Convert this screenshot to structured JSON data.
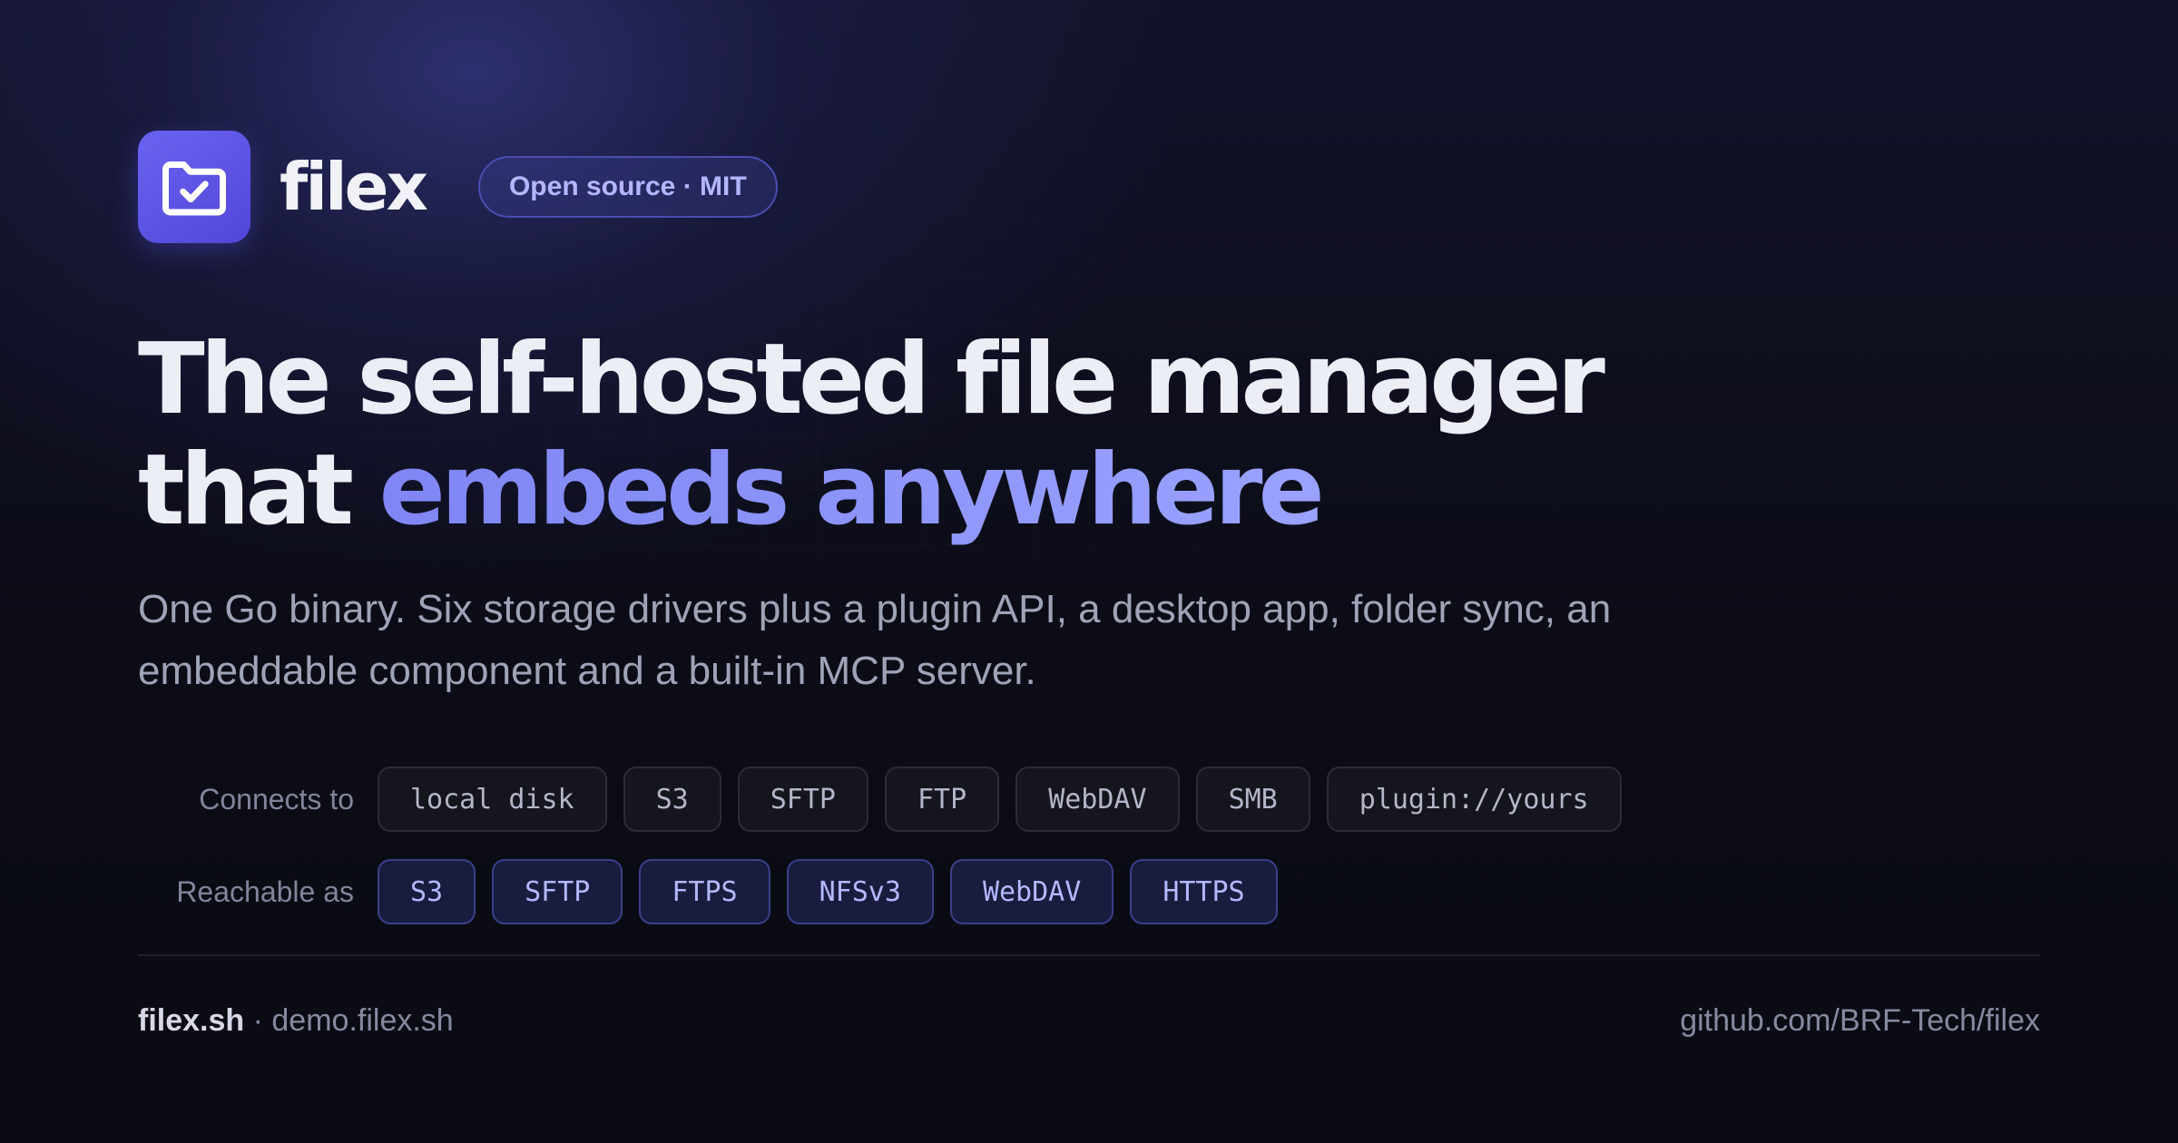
{
  "brand": {
    "name": "filex",
    "badge": "Open source · MIT"
  },
  "headline": {
    "line1": "The self-hosted file manager",
    "line2_plain": "that ",
    "line2_accent": "embeds anywhere"
  },
  "subtext": "One Go binary. Six storage drivers plus a plugin API, a desktop app, folder sync, an embeddable component and a built-in MCP server.",
  "connects": {
    "label": "Connects to",
    "chips": [
      "local disk",
      "S3",
      "SFTP",
      "FTP",
      "WebDAV",
      "SMB",
      "plugin://yours"
    ]
  },
  "reachable": {
    "label": "Reachable as",
    "chips": [
      "S3",
      "SFTP",
      "FTPS",
      "NFSv3",
      "WebDAV",
      "HTTPS"
    ]
  },
  "footer": {
    "site": "filex.sh",
    "separator": " · ",
    "demo": "demo.filex.sh",
    "repo": "github.com/BRF-Tech/filex"
  },
  "colors": {
    "accent": "#6b63f0",
    "accent_text": "#9aa2ff",
    "background": "#0a0b12"
  },
  "icons": {
    "logo": "folder-check-icon"
  }
}
